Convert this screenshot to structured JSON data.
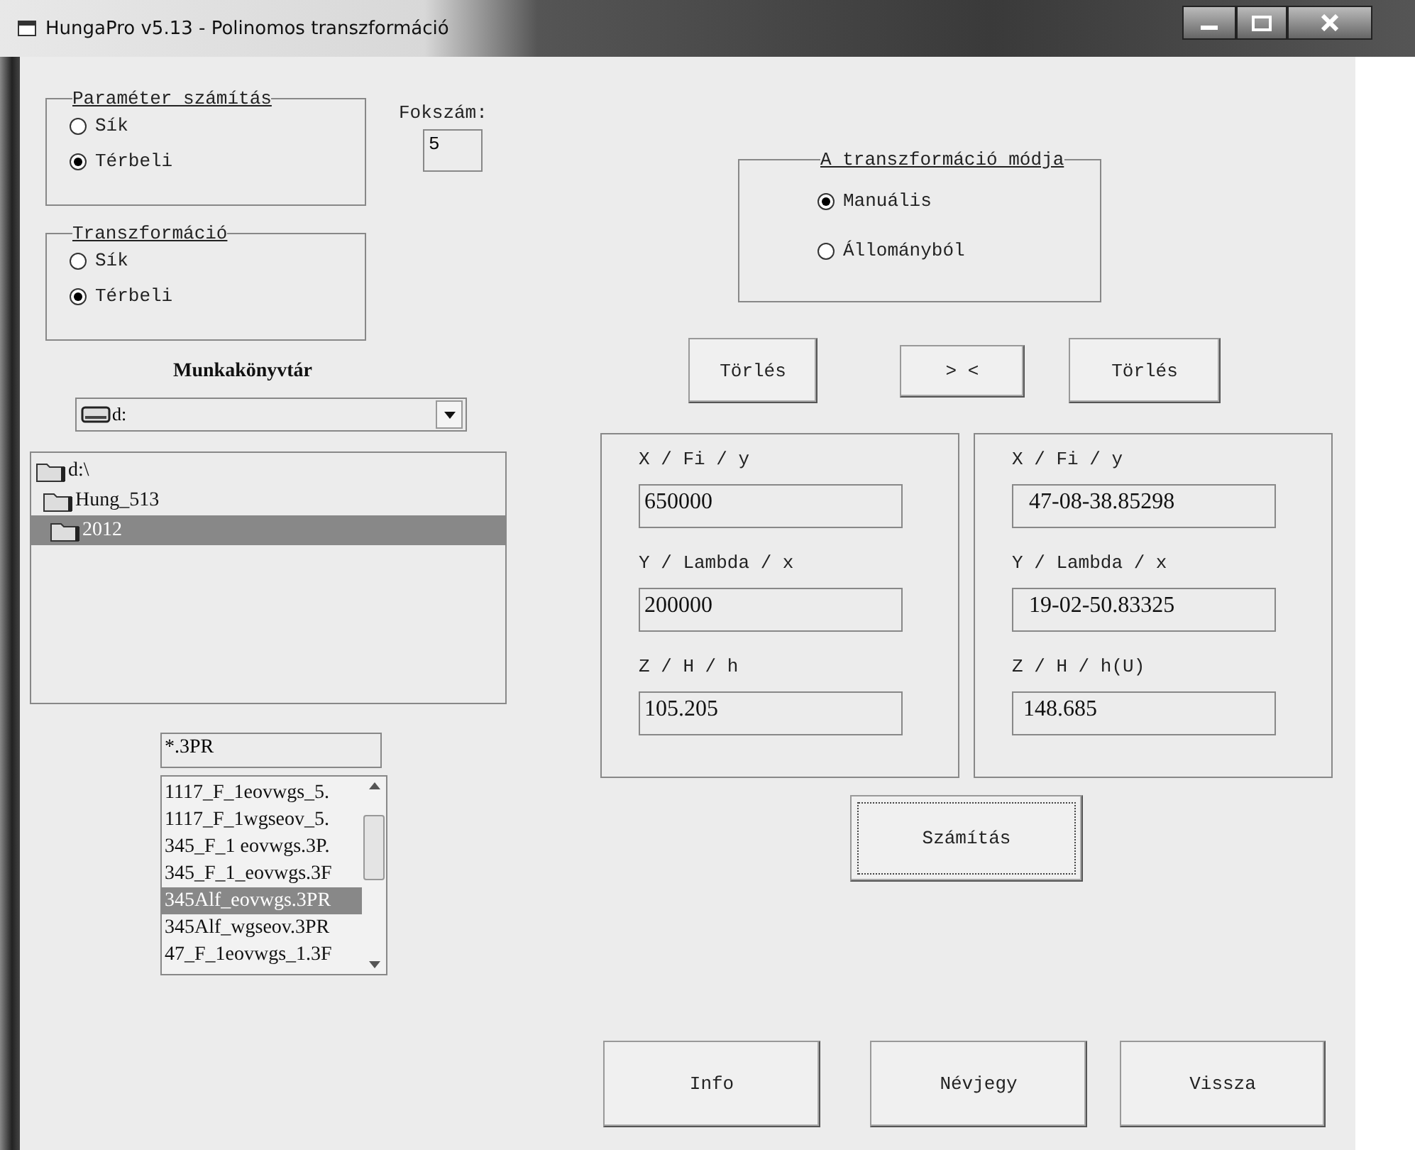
{
  "window": {
    "title": "HungaPro v5.13 - Polinomos transzformáció"
  },
  "parameter_group": {
    "title": "Paraméter számítás",
    "options": [
      {
        "label": "Sík",
        "selected": false
      },
      {
        "label": "Térbeli",
        "selected": true
      }
    ]
  },
  "degree": {
    "label": "Fokszám:",
    "value": "5"
  },
  "transform_group": {
    "title": "Transzformáció",
    "options": [
      {
        "label": "Sík",
        "selected": false
      },
      {
        "label": "Térbeli",
        "selected": true
      }
    ]
  },
  "workdir": {
    "label": "Munkakönyvtár",
    "drive": "d:",
    "folders": [
      {
        "name": "d:\\",
        "selected": false,
        "children": [
          {
            "name": "Hung_513",
            "selected": false,
            "children": [
              {
                "name": "2012",
                "selected": true
              }
            ]
          }
        ]
      }
    ]
  },
  "filter": "*.3PR",
  "files": [
    {
      "name": "1117_F_1eovwgs_5.",
      "selected": false
    },
    {
      "name": "1117_F_1wgseov_5.",
      "selected": false
    },
    {
      "name": "345_F_1 eovwgs.3P.",
      "selected": false
    },
    {
      "name": "345_F_1_eovwgs.3F",
      "selected": false
    },
    {
      "name": "345Alf_eovwgs.3PR",
      "selected": true
    },
    {
      "name": "345Alf_wgseov.3PR",
      "selected": false
    },
    {
      "name": "47_F_1eovwgs_1.3F",
      "selected": false
    }
  ],
  "mode_group": {
    "title": "A transzformáció módja",
    "options": [
      {
        "label": "Manuális",
        "selected": true
      },
      {
        "label": "Állományból",
        "selected": false
      }
    ]
  },
  "top_buttons": [
    "Törlés",
    "> <",
    "Törlés"
  ],
  "panels": [
    {
      "fields": [
        {
          "label": "X / Fi / y",
          "value": "650000"
        },
        {
          "label": "Y / Lambda / x",
          "value": "200000"
        },
        {
          "label": "Z / H / h",
          "value": "105.205"
        }
      ]
    },
    {
      "fields": [
        {
          "label": "X / Fi / y",
          "value": "  47-08-38.85298"
        },
        {
          "label": "Y / Lambda / x",
          "value": "  19-02-50.83325"
        },
        {
          "label": "Z / H / h(U)",
          "value": " 148.685"
        }
      ]
    }
  ],
  "compute_button": "Számítás",
  "bottom_buttons": [
    "Info",
    "Névjegy",
    "Vissza"
  ]
}
